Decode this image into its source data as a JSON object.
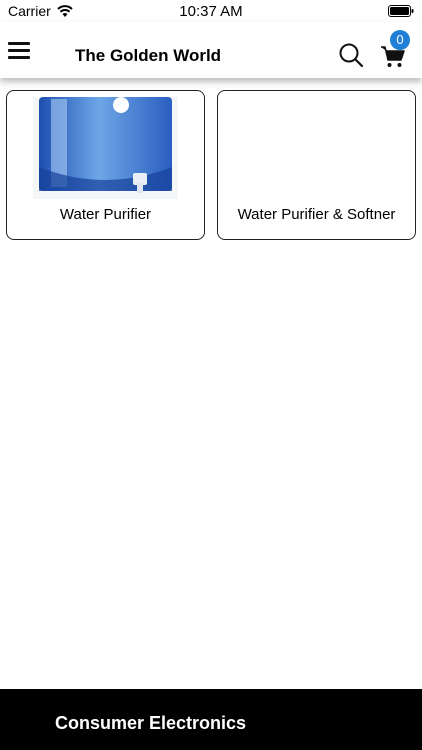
{
  "status_bar": {
    "carrier": "Carrier",
    "time": "10:37 AM"
  },
  "header": {
    "title": "The Golden World",
    "cart_count": "0"
  },
  "categories": [
    {
      "label": "Water Purifier",
      "icon": "water-purifier-image"
    },
    {
      "label": "Water Purifier & Softner",
      "icon": ""
    }
  ],
  "footer": {
    "label": "Consumer Electronics"
  },
  "colors": {
    "badge": "#1f7fd6",
    "footer_bg": "#000000"
  }
}
